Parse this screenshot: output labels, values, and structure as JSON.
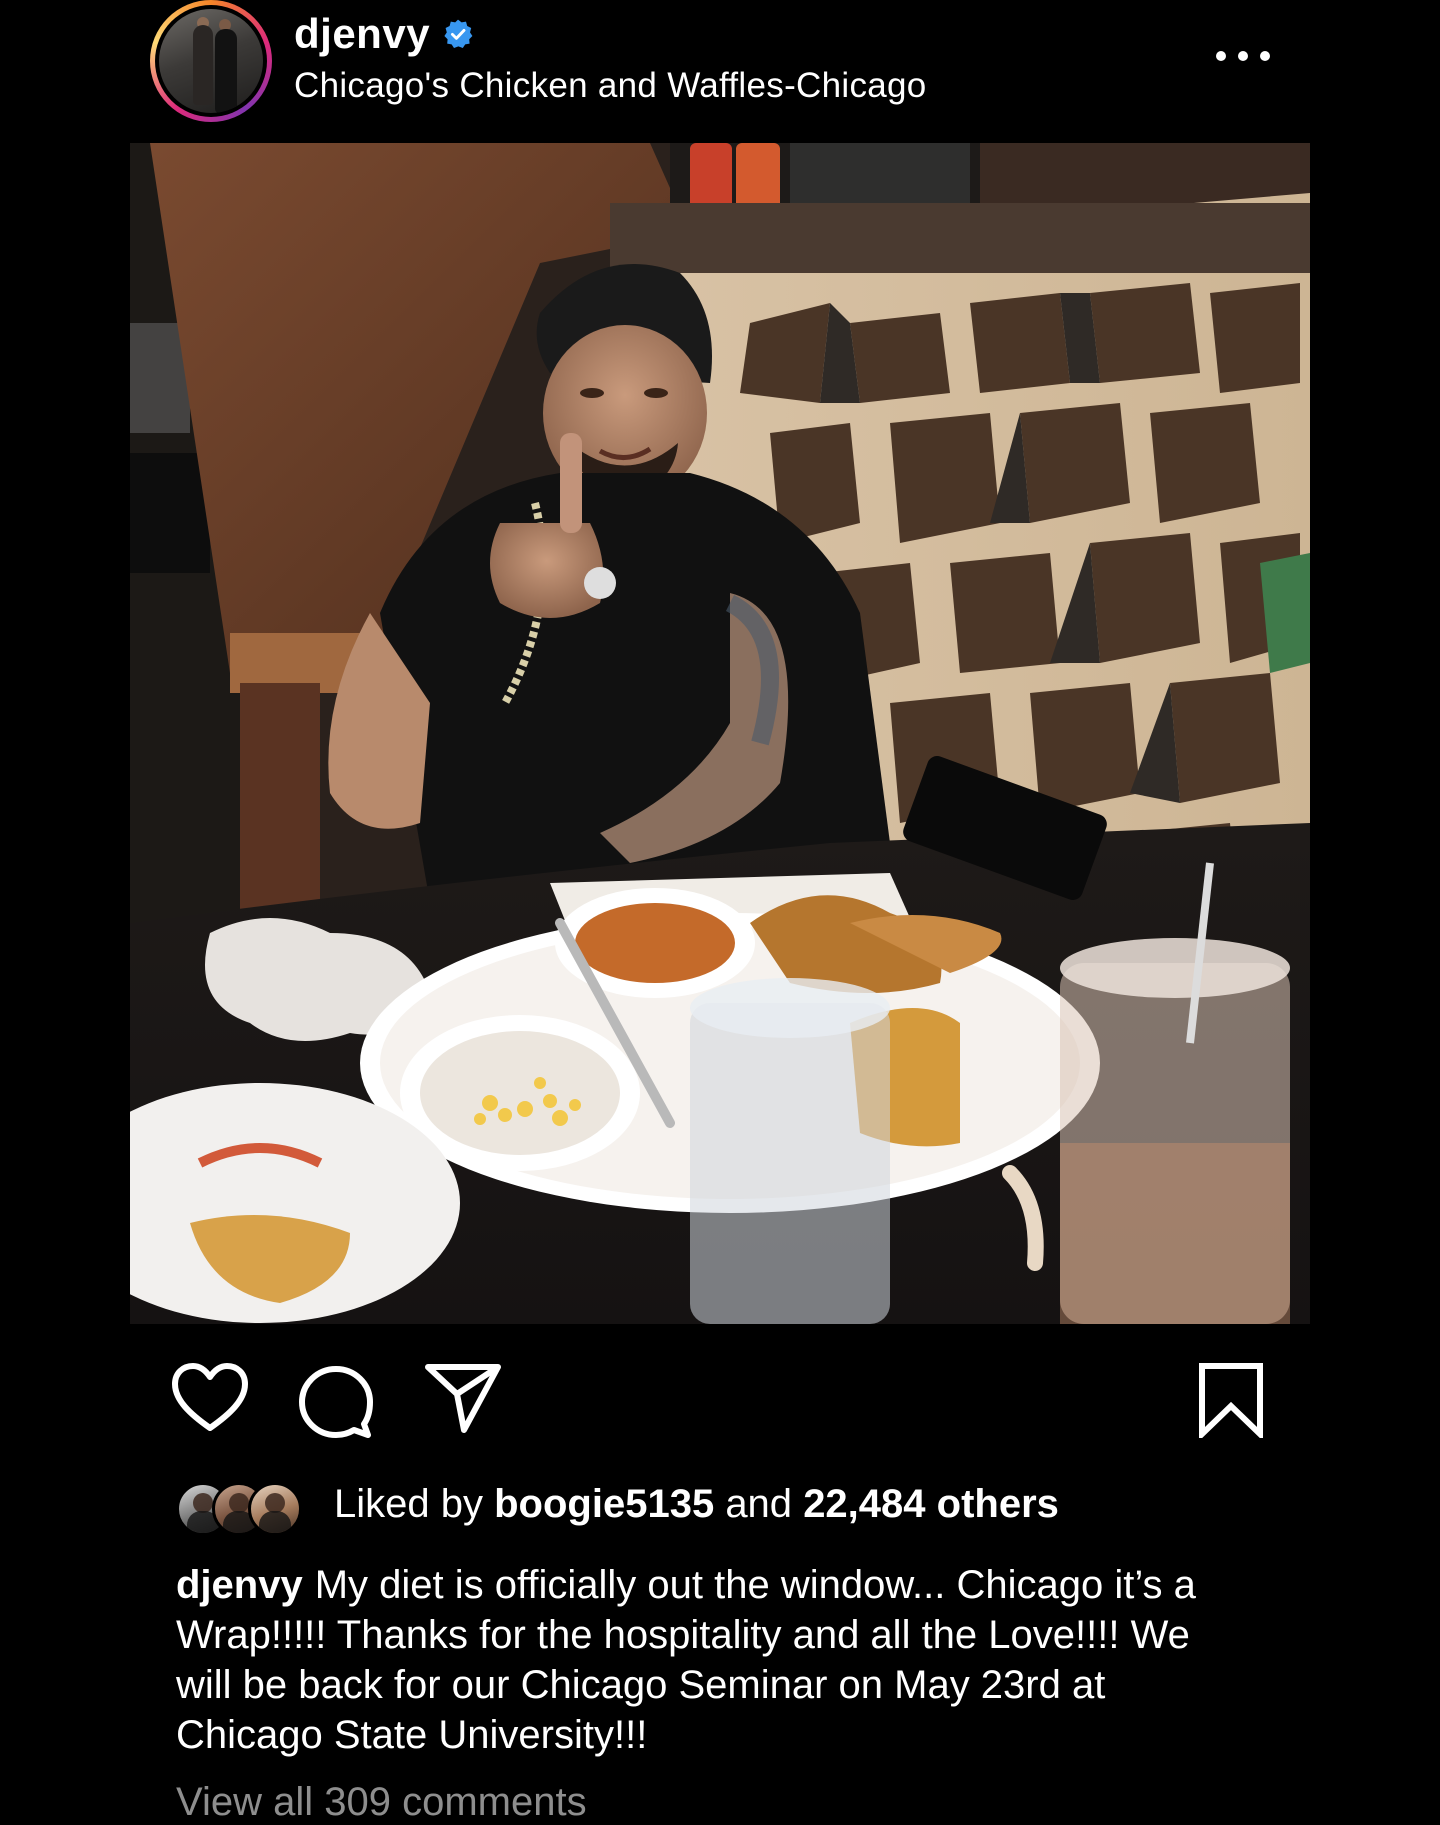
{
  "header": {
    "username": "djenvy",
    "verified": true,
    "location": "Chicago's Chicken and Waffles-Chicago",
    "avatar_icon": "profile-avatar",
    "more_icon": "more-horizontal-icon"
  },
  "post": {
    "photo_icon": "post-photo"
  },
  "actions": {
    "like_icon": "heart-outline-icon",
    "comment_icon": "comment-bubble-icon",
    "share_icon": "paper-plane-icon",
    "save_icon": "bookmark-outline-icon"
  },
  "likes": {
    "prefix": "Liked by",
    "first_liker": "boogie5135",
    "middle": "and",
    "others": "22,484 others"
  },
  "caption": {
    "username": "djenvy",
    "text": "My diet is officially out the window... Chicago it’s a Wrap!!!!! Thanks for the hospitality and all the Love!!!! We will be back for our Chicago Seminar on May 23rd at Chicago State University!!!"
  },
  "comments": {
    "view_all": "View all 309 comments"
  },
  "colors": {
    "background": "#000000",
    "text": "#ffffff",
    "verified_blue": "#3897f0",
    "muted": "#8e8e8e"
  }
}
